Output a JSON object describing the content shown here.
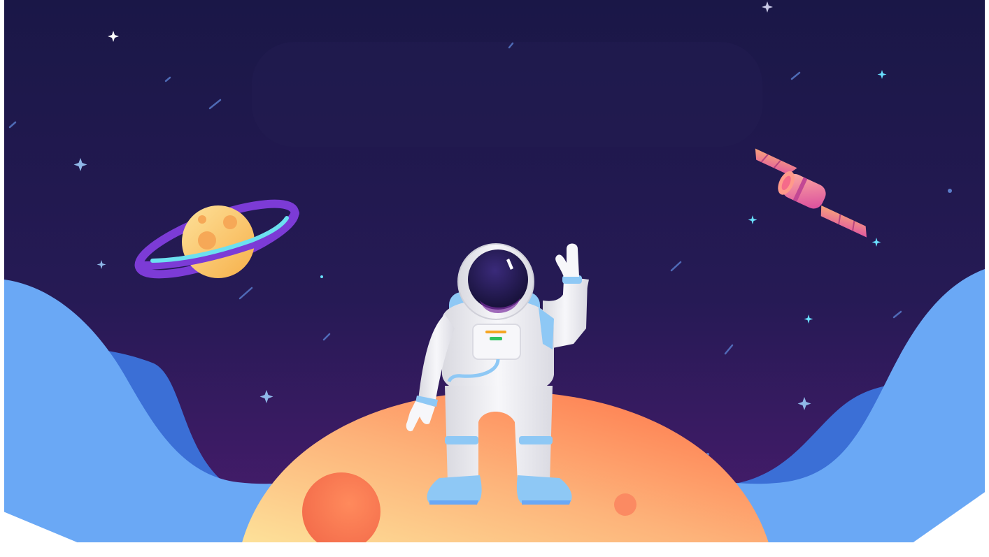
{
  "scene": {
    "elements": [
      "space-background",
      "stars",
      "ringed-planet",
      "satellite",
      "blue-hills",
      "orange-moon",
      "astronaut"
    ]
  },
  "colors": {
    "sky_top": "#1a1747",
    "sky_bottom": "#4a1c6e",
    "hill_light": "#6aa8f5",
    "hill_dark": "#3b6fd6",
    "moon_light": "#fde29a",
    "moon_dark": "#ff7a52",
    "planet": "#f9c25e",
    "ring_outer": "#7c3bd6",
    "ring_inner": "#6ce0f0",
    "suit": "#f1f1f4",
    "suit_trim": "#8ec8f5",
    "satellite_body": "#ff8fb3",
    "satellite_panel": "#f49a7c",
    "star": "#9fd9ff"
  }
}
